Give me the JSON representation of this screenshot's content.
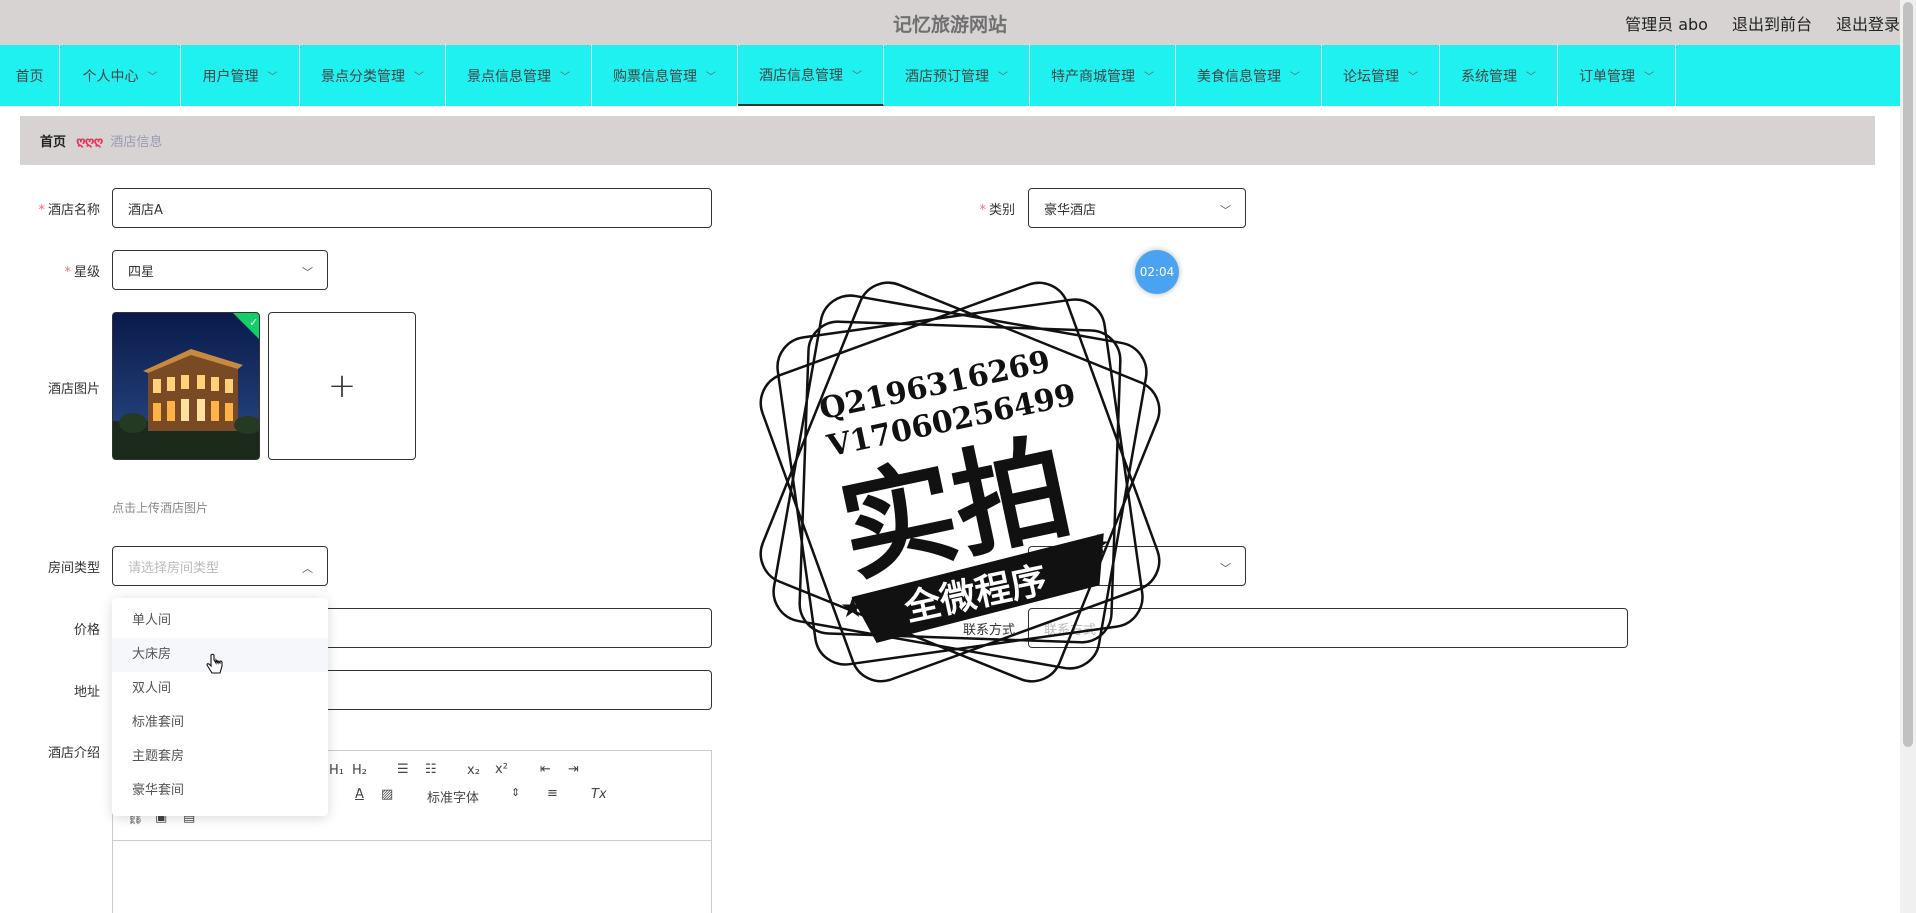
{
  "header": {
    "site_title": "记忆旅游网站",
    "admin_label": "管理员 abo",
    "back_to_front": "退出到前台",
    "logout": "退出登录"
  },
  "nav": {
    "items": [
      {
        "label": "首页",
        "has_dropdown": false
      },
      {
        "label": "个人中心",
        "has_dropdown": true
      },
      {
        "label": "用户管理",
        "has_dropdown": true
      },
      {
        "label": "景点分类管理",
        "has_dropdown": true
      },
      {
        "label": "景点信息管理",
        "has_dropdown": true
      },
      {
        "label": "购票信息管理",
        "has_dropdown": true
      },
      {
        "label": "酒店信息管理",
        "has_dropdown": true,
        "active": true
      },
      {
        "label": "酒店预订管理",
        "has_dropdown": true
      },
      {
        "label": "特产商城管理",
        "has_dropdown": true
      },
      {
        "label": "美食信息管理",
        "has_dropdown": true
      },
      {
        "label": "论坛管理",
        "has_dropdown": true
      },
      {
        "label": "系统管理",
        "has_dropdown": true
      },
      {
        "label": "订单管理",
        "has_dropdown": true
      }
    ],
    "chevron_icon": "chevron-down-icon"
  },
  "breadcrumb": {
    "home": "首页",
    "separator": "ღღღ",
    "current": "酒店信息"
  },
  "form": {
    "hotel_name": {
      "label": "酒店名称",
      "value": "酒店A"
    },
    "category": {
      "label": "类别",
      "value": "豪华酒店"
    },
    "star_level": {
      "label": "星级",
      "value": "四星"
    },
    "hotel_image": {
      "label": "酒店图片",
      "hint": "点击上传酒店图片",
      "add_symbol": "+"
    },
    "room_type": {
      "label": "房间类型",
      "placeholder": "请选择房间类型"
    },
    "room_type_right": {
      "placeholder": "请选择"
    },
    "price": {
      "label": "价格"
    },
    "contact": {
      "label": "联系方式",
      "placeholder": "联系方式"
    },
    "address": {
      "label": "地址"
    },
    "intro": {
      "label": "酒店介绍"
    }
  },
  "dropdown": {
    "options": [
      "单人间",
      "大床房",
      "双人间",
      "标准套间",
      "主题套房",
      "豪华套间"
    ],
    "hovered_index": 1
  },
  "editor": {
    "toolbar": {
      "h1": "H₁",
      "h2": "H₂",
      "sub": "x₂",
      "sup": "x²",
      "font_select": "标准字体",
      "clear": "Tx"
    }
  },
  "timer": {
    "text": "02:04"
  },
  "watermark": {
    "line1": "Q2196316269",
    "line2": "V17060256499",
    "main": "实拍",
    "banner": "全微程序"
  },
  "colors": {
    "nav_bg": "#1ef1f0",
    "topbar_bg": "#d8d3d3",
    "required": "#f56c6c",
    "timer": "#4aa3f0"
  }
}
